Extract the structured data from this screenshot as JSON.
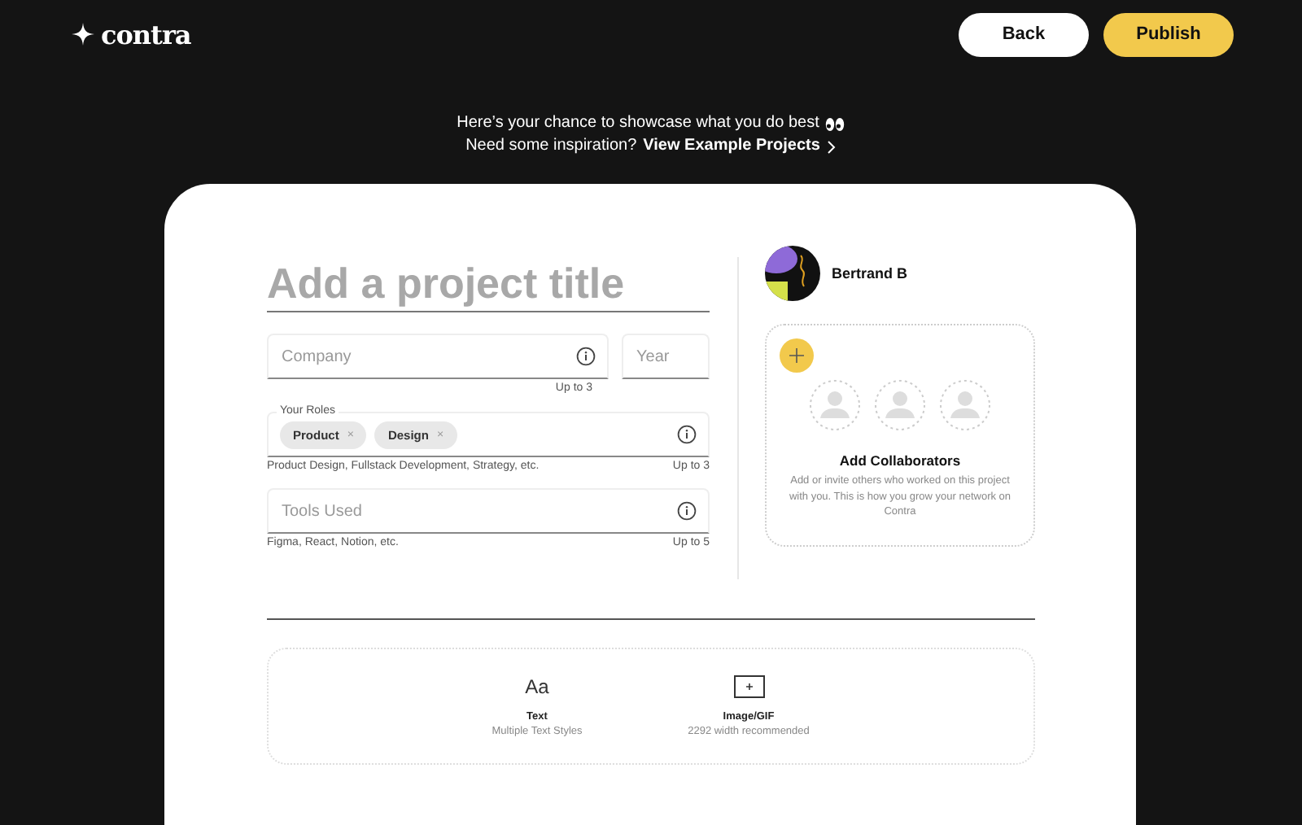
{
  "header": {
    "logo": "contra",
    "buttons": [
      {
        "label": "Back",
        "kind": "secondary"
      },
      {
        "label": "Publish",
        "kind": "primary"
      }
    ]
  },
  "intro": {
    "line_1": "Here’s your chance to showcase what you do best",
    "line_2": "Need some inspiration?",
    "link": "View Example Projects"
  },
  "form": {
    "title": {
      "placeholder": "Add a project title"
    },
    "company": {
      "placeholder": "Company",
      "hint": "Up to 3"
    },
    "year": {
      "placeholder": "Year"
    },
    "roles": {
      "label": "Your Roles",
      "chips": [
        {
          "label": "Product",
          "remove": "×"
        },
        {
          "label": "Design",
          "remove": "×"
        }
      ],
      "help": "Product Design, Fullstack Development, Strategy, etc.",
      "hint": "Up to 3"
    },
    "tools": {
      "placeholder": "Tools Used",
      "help": "Figma, React, Notion, etc.",
      "hint": "Up to 5"
    }
  },
  "profile": {
    "name": "Bertrand B"
  },
  "collaborators": {
    "title": "Add Collaborators",
    "description": "Add or invite others who worked on this project with you. This is how you grow your network on Contra"
  },
  "blocks": [
    {
      "kind": "text",
      "glyph": "Aa",
      "title": "Text",
      "subtitle": "Multiple Text Styles"
    },
    {
      "kind": "image",
      "title": "Image/GIF",
      "subtitle": "2292 width recommended"
    }
  ]
}
